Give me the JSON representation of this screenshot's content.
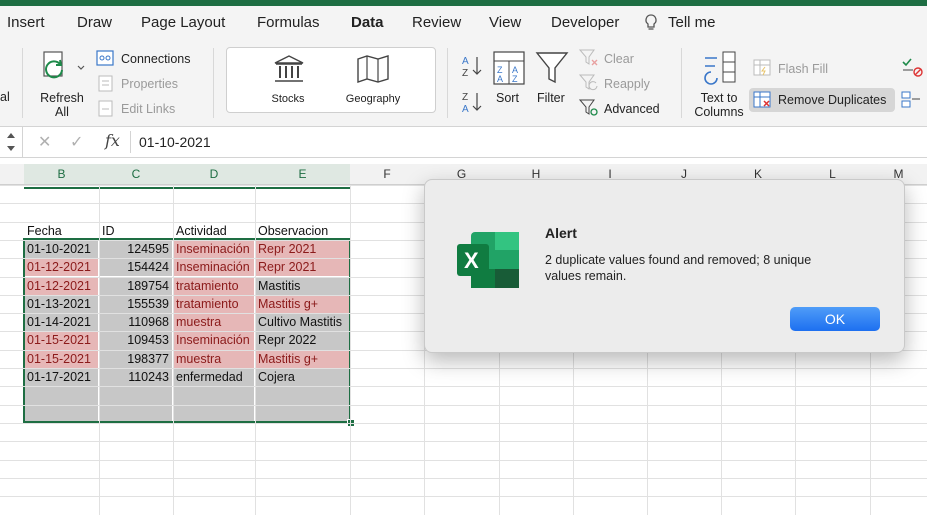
{
  "tabs": [
    "Insert",
    "Draw",
    "Page Layout",
    "Formulas",
    "Data",
    "Review",
    "View",
    "Developer",
    "Tell me"
  ],
  "active_tab": "Data",
  "ribbon": {
    "edge_label": "al",
    "refresh_all": [
      "Refresh",
      "All"
    ],
    "connections": "Connections",
    "properties": "Properties",
    "edit_links": "Edit Links",
    "stocks": "Stocks",
    "geography": "Geography",
    "sort": "Sort",
    "filter": "Filter",
    "clear": "Clear",
    "reapply": "Reapply",
    "advanced": "Advanced",
    "text_to_columns": [
      "Text to",
      "Columns"
    ],
    "flash_fill": "Flash Fill",
    "remove_duplicates": "Remove Duplicates"
  },
  "formula_bar": {
    "cancel_symbol": "✕",
    "enter_symbol": "✓",
    "fx_label": "fx",
    "value": "01-10-2021"
  },
  "columns": [
    "B",
    "C",
    "D",
    "E",
    "F",
    "G",
    "H",
    "I",
    "J",
    "K",
    "L",
    "M"
  ],
  "sheet": {
    "headers": [
      "Fecha",
      "ID",
      "Actividad",
      "Observacion"
    ],
    "rows": [
      {
        "fecha": "01-10-2021",
        "id": "124595",
        "actividad": "Inseminación",
        "observacion": "Repr 2021",
        "dup": [
          false,
          false,
          true,
          true
        ]
      },
      {
        "fecha": "01-12-2021",
        "id": "154424",
        "actividad": "Inseminación",
        "observacion": "Repr 2021",
        "dup": [
          true,
          false,
          true,
          true
        ]
      },
      {
        "fecha": "01-12-2021",
        "id": "189754",
        "actividad": "tratamiento",
        "observacion": "Mastitis",
        "dup": [
          true,
          false,
          true,
          false
        ]
      },
      {
        "fecha": "01-13-2021",
        "id": "155539",
        "actividad": "tratamiento",
        "observacion": "Mastitis g+",
        "dup": [
          false,
          false,
          true,
          true
        ]
      },
      {
        "fecha": "01-14-2021",
        "id": "110968",
        "actividad": "muestra",
        "observacion": "Cultivo Mastitis",
        "dup": [
          false,
          false,
          true,
          false
        ]
      },
      {
        "fecha": "01-15-2021",
        "id": "109453",
        "actividad": "Inseminación",
        "observacion": "Repr 2022",
        "dup": [
          true,
          false,
          true,
          false
        ]
      },
      {
        "fecha": "01-15-2021",
        "id": "198377",
        "actividad": "muestra",
        "observacion": "Mastitis g+",
        "dup": [
          true,
          false,
          true,
          true
        ]
      },
      {
        "fecha": "01-17-2021",
        "id": "110243",
        "actividad": "enfermedad",
        "observacion": "Cojera",
        "dup": [
          false,
          false,
          false,
          false
        ]
      }
    ],
    "empty_rows": 2
  },
  "dialog": {
    "title": "Alert",
    "message": "2 duplicate values found and removed; 8 unique values remain.",
    "ok_label": "OK"
  },
  "colors": {
    "accent_green": "#1e6e43",
    "duplicate_fill": "#e6b7b7",
    "duplicate_text": "#8b1a1a",
    "selection_fill": "#c7c7c7",
    "ok_button": "#1d6ff0"
  }
}
